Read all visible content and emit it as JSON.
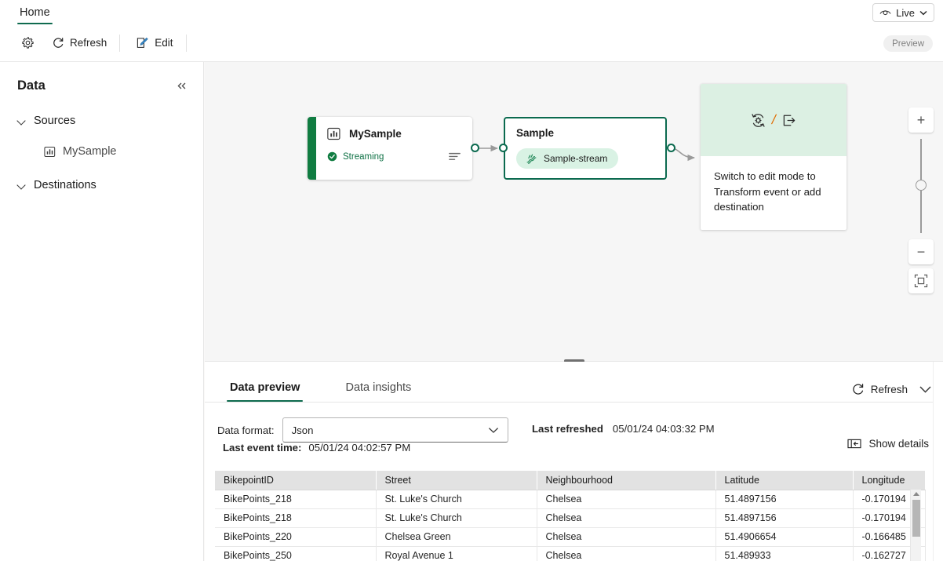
{
  "topbar": {
    "tab_home": "Home",
    "live_label": "Live",
    "live_icon": "eye-icon",
    "chevron_icon": "chevron-down-icon"
  },
  "commandbar": {
    "settings_icon": "gear-icon",
    "refresh_label": "Refresh",
    "refresh_icon": "refresh-icon",
    "edit_label": "Edit",
    "edit_icon": "edit-pencil-icon",
    "preview_badge": "Preview"
  },
  "sidebar": {
    "title": "Data",
    "collapse_icon": "double-chevron-left-icon",
    "groups": [
      {
        "label": "Sources",
        "expanded": true,
        "children": [
          {
            "label": "MySample",
            "icon": "bar-chart-icon"
          }
        ]
      },
      {
        "label": "Destinations",
        "expanded": true,
        "children": []
      }
    ]
  },
  "canvas": {
    "source_node": {
      "title": "MySample",
      "icon": "bar-chart-icon",
      "status": "Streaming",
      "status_icon": "check-circle-icon",
      "menu_icon": "lines-menu-icon",
      "accent_color": "#107c41"
    },
    "stream_node": {
      "title": "Sample",
      "pill_label": "Sample-stream",
      "pill_icon": "stream-icon",
      "border_color": "#0b6a4f"
    },
    "placeholder_node": {
      "transform_icon": "transform-event-icon",
      "separator": "/",
      "destination_icon": "add-destination-icon",
      "text": "Switch to edit mode to Transform event or add destination"
    },
    "zoom_controls": {
      "zoom_in": "+",
      "zoom_out": "−",
      "fit_icon": "fit-to-screen-icon"
    }
  },
  "bottom": {
    "tabs": [
      {
        "label": "Data preview",
        "active": true
      },
      {
        "label": "Data insights",
        "active": false
      }
    ],
    "refresh_label": "Refresh",
    "refresh_icon": "refresh-icon",
    "collapse_icon": "chevron-down-icon",
    "data_format_label": "Data format:",
    "data_format_value": "Json",
    "data_format_options": [
      "Json"
    ],
    "last_refreshed_label": "Last refreshed",
    "last_refreshed_value": "05/01/24 04:03:32 PM",
    "last_event_time_label": "Last event time:",
    "last_event_time_value": "05/01/24 04:02:57 PM",
    "show_details_label": "Show details",
    "show_details_icon": "details-panel-icon"
  },
  "table": {
    "columns": [
      "BikepointID",
      "Street",
      "Neighbourhood",
      "Latitude",
      "Longitude"
    ],
    "rows": [
      [
        "BikePoints_218",
        "St. Luke's Church",
        "Chelsea",
        "51.4897156",
        "-0.170194"
      ],
      [
        "BikePoints_218",
        "St. Luke's Church",
        "Chelsea",
        "51.4897156",
        "-0.170194"
      ],
      [
        "BikePoints_220",
        "Chelsea Green",
        "Chelsea",
        "51.4906654",
        "-0.166485"
      ],
      [
        "BikePoints_250",
        "Royal Avenue 1",
        "Chelsea",
        "51.489933",
        "-0.162727"
      ]
    ]
  }
}
